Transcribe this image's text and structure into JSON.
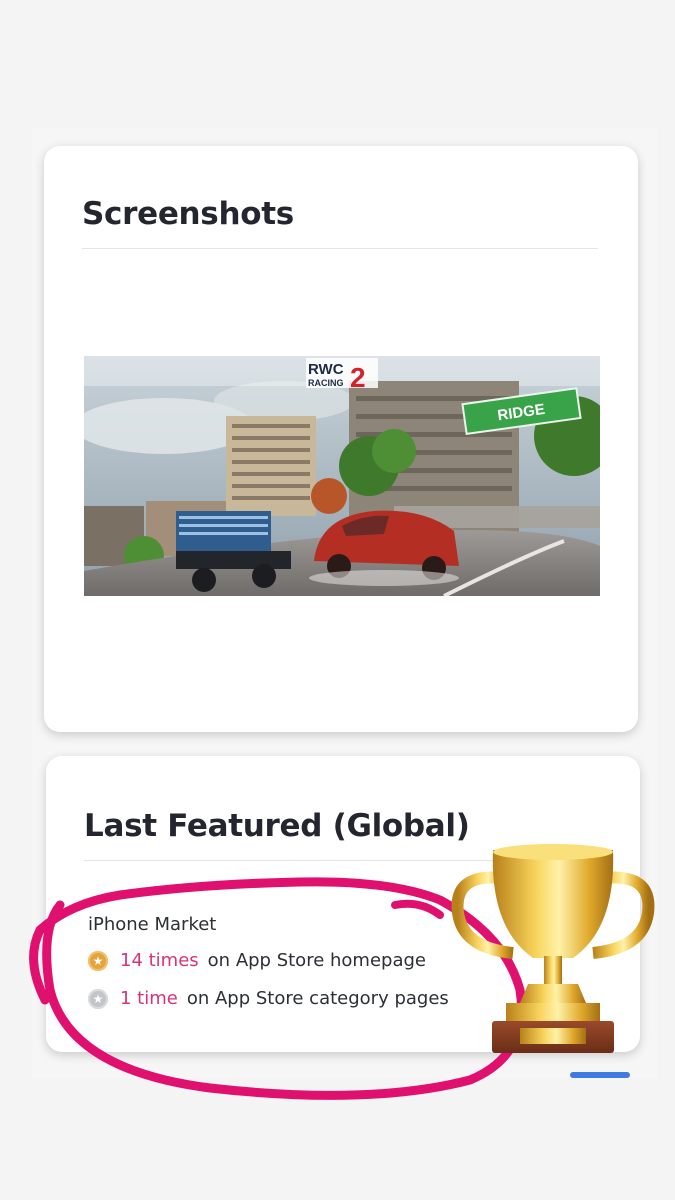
{
  "screenshots_card": {
    "title": "Screenshots",
    "screenshot": {
      "logo_main": "RWC",
      "logo_number": "2",
      "logo_sub": "RACING",
      "sign_text": "RIDGE"
    }
  },
  "featured_card": {
    "title": "Last Featured (Global)",
    "market_label": "iPhone Market",
    "rows": [
      {
        "icon": "star-gold-icon",
        "count": "14 times",
        "text": "on App Store homepage"
      },
      {
        "icon": "star-silver-icon",
        "count": "1 time",
        "text": "on App Store category pages"
      }
    ]
  },
  "colors": {
    "accent_pink": "#d6337a",
    "gold_medal": "#e6a23c",
    "silver_medal": "#c3c5c9",
    "annotation_circle": "#e0106e"
  }
}
